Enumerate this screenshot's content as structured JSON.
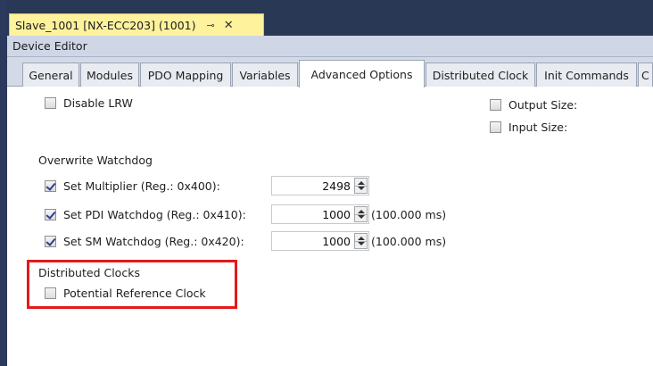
{
  "document_tab": {
    "title": "Slave_1001 [NX-ECC203] (1001)",
    "pin_icon": "pin-icon",
    "close_icon": "close-icon",
    "pin_glyph": "⊸",
    "close_glyph": "✕"
  },
  "editor": {
    "title": "Device Editor"
  },
  "tabs": [
    {
      "label": "General"
    },
    {
      "label": "Modules"
    },
    {
      "label": "PDO Mapping"
    },
    {
      "label": "Variables"
    },
    {
      "label": "Advanced Options"
    },
    {
      "label": "Distributed Clock"
    },
    {
      "label": "Init Commands"
    },
    {
      "label": "C"
    }
  ],
  "active_tab": "Advanced Options",
  "options": {
    "disable_lrw": {
      "label": "Disable LRW",
      "checked": false
    },
    "output_size": {
      "label": "Output Size:",
      "checked": false
    },
    "input_size": {
      "label": "Input Size:",
      "checked": false
    }
  },
  "watchdog": {
    "title": "Overwrite Watchdog",
    "rows": [
      {
        "label": "Set Multiplier (Reg.: 0x400):",
        "checked": true,
        "value": "2498",
        "unit": ""
      },
      {
        "label": "Set PDI Watchdog (Reg.: 0x410):",
        "checked": true,
        "value": "1000",
        "unit": "(100.000 ms)"
      },
      {
        "label": "Set SM Watchdog (Reg.: 0x420):",
        "checked": true,
        "value": "1000",
        "unit": "(100.000 ms)"
      }
    ]
  },
  "distributed_clocks": {
    "title": "Distributed Clocks",
    "potential_reference_clock": {
      "label": "Potential Reference Clock",
      "checked": false
    }
  },
  "colors": {
    "doc_tab_bg": "#fff29d",
    "dark_chrome": "#293955",
    "highlight": "#e3191b"
  }
}
